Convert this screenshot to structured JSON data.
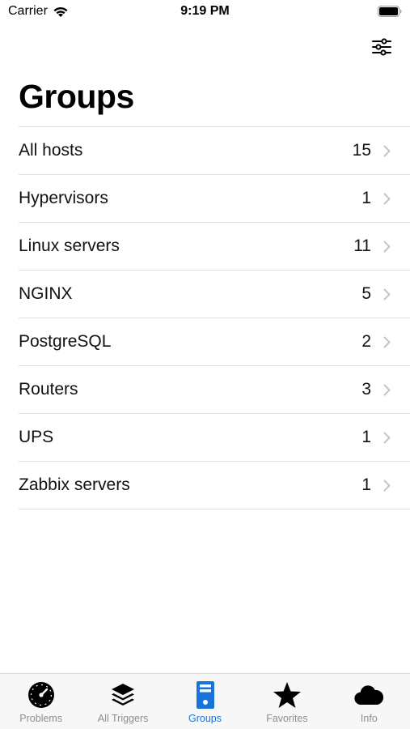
{
  "status_bar": {
    "carrier": "Carrier",
    "time": "9:19 PM",
    "icons": [
      "wifi-icon",
      "battery-icon"
    ]
  },
  "header": {
    "title": "Groups",
    "filter_icon": "sliders-icon"
  },
  "groups": [
    {
      "name": "All hosts",
      "count": "15"
    },
    {
      "name": "Hypervisors",
      "count": "1"
    },
    {
      "name": "Linux servers",
      "count": "11"
    },
    {
      "name": "NGINX",
      "count": "5"
    },
    {
      "name": "PostgreSQL",
      "count": "2"
    },
    {
      "name": "Routers",
      "count": "3"
    },
    {
      "name": "UPS",
      "count": "1"
    },
    {
      "name": "Zabbix servers",
      "count": "1"
    }
  ],
  "tab_bar": {
    "tabs": [
      {
        "label": "Problems",
        "icon": "gauge-icon",
        "active": false
      },
      {
        "label": "All Triggers",
        "icon": "layers-icon",
        "active": false
      },
      {
        "label": "Groups",
        "icon": "server-icon",
        "active": true
      },
      {
        "label": "Favorites",
        "icon": "star-icon",
        "active": false
      },
      {
        "label": "Info",
        "icon": "cloud-icon",
        "active": false
      }
    ]
  },
  "colors": {
    "accent": "#1a73d9",
    "inactive": "#8e8e93",
    "separator": "#e2e2e2"
  }
}
